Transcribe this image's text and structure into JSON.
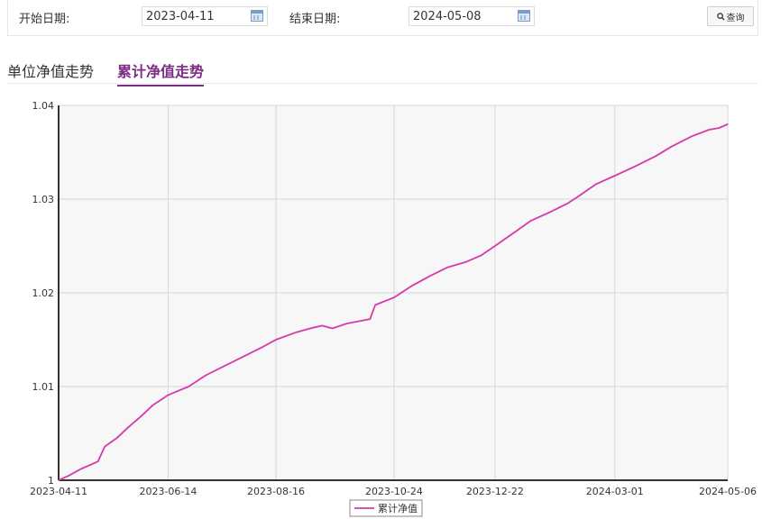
{
  "filters": {
    "start_label": "开始日期:",
    "start_value": "2023-04-11",
    "end_label": "结束日期:",
    "end_value": "2024-05-08",
    "query_label": "查询"
  },
  "tabs": [
    {
      "label": "单位净值走势",
      "active": false
    },
    {
      "label": "累计净值走势",
      "active": true
    }
  ],
  "colors": {
    "line": "#d63aa8",
    "tab_active": "#7b2c83",
    "plot_bg": "#f7f7f7"
  },
  "chart_data": {
    "type": "line",
    "x_ticks": [
      "2023-04-11",
      "2023-06-14",
      "2023-08-16",
      "2023-10-24",
      "2023-12-22",
      "2024-03-01",
      "2024-05-06"
    ],
    "y_ticks": [
      "1",
      "1.01",
      "1.02",
      "1.03",
      "1.04"
    ],
    "ylim": [
      1.0,
      1.04
    ],
    "xlim": [
      "2023-04-11",
      "2024-05-06"
    ],
    "grid": true,
    "legend_position": "bottom-center",
    "series": [
      {
        "name": "累计净值",
        "points": [
          [
            "2023-04-11",
            1.0
          ],
          [
            "2023-04-17",
            1.0005
          ],
          [
            "2023-04-24",
            1.0012
          ],
          [
            "2023-05-04",
            1.002
          ],
          [
            "2023-05-08",
            1.0036
          ],
          [
            "2023-05-15",
            1.0045
          ],
          [
            "2023-05-22",
            1.0057
          ],
          [
            "2023-05-29",
            1.0068
          ],
          [
            "2023-06-05",
            1.008
          ],
          [
            "2023-06-14",
            1.0091
          ],
          [
            "2023-06-26",
            1.01
          ],
          [
            "2023-07-06",
            1.0112
          ],
          [
            "2023-07-17",
            1.0122
          ],
          [
            "2023-07-28",
            1.0132
          ],
          [
            "2023-08-08",
            1.0142
          ],
          [
            "2023-08-16",
            1.015
          ],
          [
            "2023-08-28",
            1.0158
          ],
          [
            "2023-09-05",
            1.0162
          ],
          [
            "2023-09-12",
            1.0165
          ],
          [
            "2023-09-18",
            1.0162
          ],
          [
            "2023-09-26",
            1.0167
          ],
          [
            "2023-10-10",
            1.0172
          ],
          [
            "2023-10-13",
            1.0187
          ],
          [
            "2023-10-24",
            1.0195
          ],
          [
            "2023-11-03",
            1.0207
          ],
          [
            "2023-11-14",
            1.0218
          ],
          [
            "2023-11-24",
            1.0227
          ],
          [
            "2023-12-05",
            1.0233
          ],
          [
            "2023-12-14",
            1.024
          ],
          [
            "2023-12-22",
            1.025
          ],
          [
            "2024-01-02",
            1.0264
          ],
          [
            "2024-01-12",
            1.0277
          ],
          [
            "2024-01-23",
            1.0286
          ],
          [
            "2024-02-02",
            1.0295
          ],
          [
            "2024-02-08",
            1.0302
          ],
          [
            "2024-02-19",
            1.0316
          ],
          [
            "2024-03-01",
            1.0325
          ],
          [
            "2024-03-13",
            1.0335
          ],
          [
            "2024-03-25",
            1.0346
          ],
          [
            "2024-04-03",
            1.0356
          ],
          [
            "2024-04-15",
            1.0367
          ],
          [
            "2024-04-25",
            1.0374
          ],
          [
            "2024-05-01",
            1.0376
          ],
          [
            "2024-05-06",
            1.038
          ]
        ]
      }
    ]
  }
}
